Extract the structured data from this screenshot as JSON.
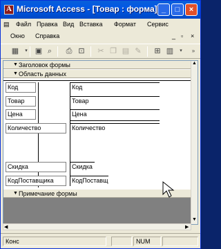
{
  "window": {
    "title": "Microsoft Access - [Товар : форма]",
    "controls": [
      "_",
      "□",
      "×"
    ]
  },
  "menu": {
    "items": [
      "Файл",
      "Правка",
      "Вид",
      "Вставка",
      "Формат",
      "Сервис"
    ],
    "row2": [
      "Окно",
      "Справка"
    ],
    "doc_controls": [
      "_",
      "▫",
      "×"
    ]
  },
  "toolbar": {
    "icons": [
      "view-icon",
      "save-icon",
      "search-icon",
      "print-icon",
      "preview-icon",
      "cut-icon",
      "copy-icon",
      "paste-icon",
      "format-painter-icon",
      "insert-icon",
      "properties-icon"
    ]
  },
  "form": {
    "sections": {
      "header": "Заголовок формы",
      "detail": "Область данных",
      "footer": "Примечание формы"
    },
    "fields": [
      {
        "label": "Код",
        "control": "Код"
      },
      {
        "label": "Товар",
        "control": "Товар"
      },
      {
        "label": "Цена",
        "control": "Цена"
      },
      {
        "label": "Количество",
        "control": "Количество"
      },
      {
        "label": "Скидка",
        "control": "Скидка"
      },
      {
        "label": "КодПоставщика",
        "control": "КодПоставщ"
      }
    ]
  },
  "status": {
    "mode": "Конс",
    "num": "NUM"
  }
}
